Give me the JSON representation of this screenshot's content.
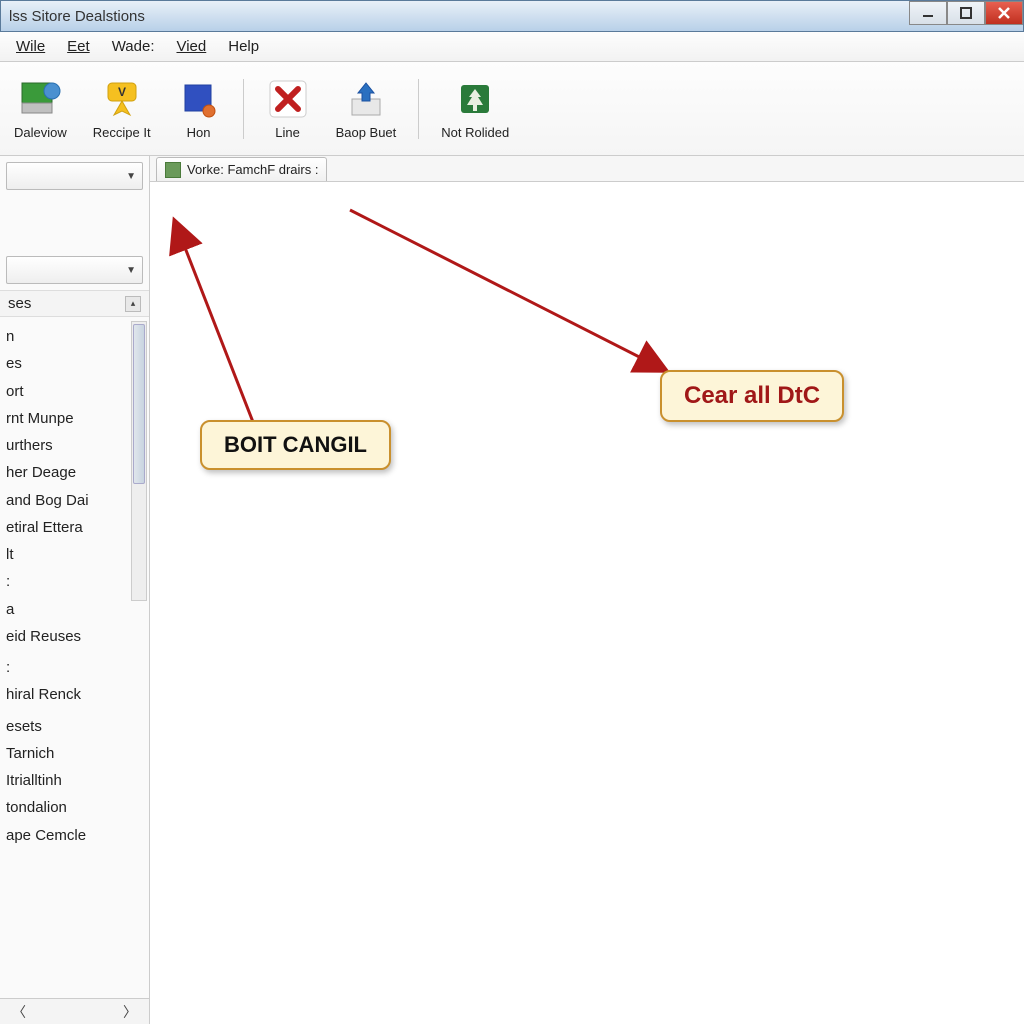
{
  "window": {
    "title": "lss Sitore Dealstions"
  },
  "menu": {
    "items": [
      "Wile",
      "Eet",
      "Wade:",
      "Vied",
      "Help"
    ]
  },
  "toolbar": {
    "daleviow": "Daleviow",
    "reccipe": "Reccipe It",
    "hon": "Hon",
    "line": "Line",
    "baop": "Baop Buet",
    "notrolided": "Not Rolided"
  },
  "sidebar": {
    "header": "ses",
    "items": [
      "n",
      "es",
      "ort",
      "rnt Munpe",
      "urthers",
      "her Deage",
      "and Bog Dai",
      "etiral Ettera",
      "lt",
      ":",
      "a",
      "eid Reuses",
      "",
      ":",
      "hiral Renck",
      "",
      "esets",
      "Tarnich",
      "Itrialltinh",
      "tondalion",
      "ape Cemcle"
    ]
  },
  "content": {
    "tab_label": "Vorke: FamchF drairs :"
  },
  "annotations": {
    "callout1": "BOIT CANGIL",
    "callout2": "Cear all DtC"
  }
}
